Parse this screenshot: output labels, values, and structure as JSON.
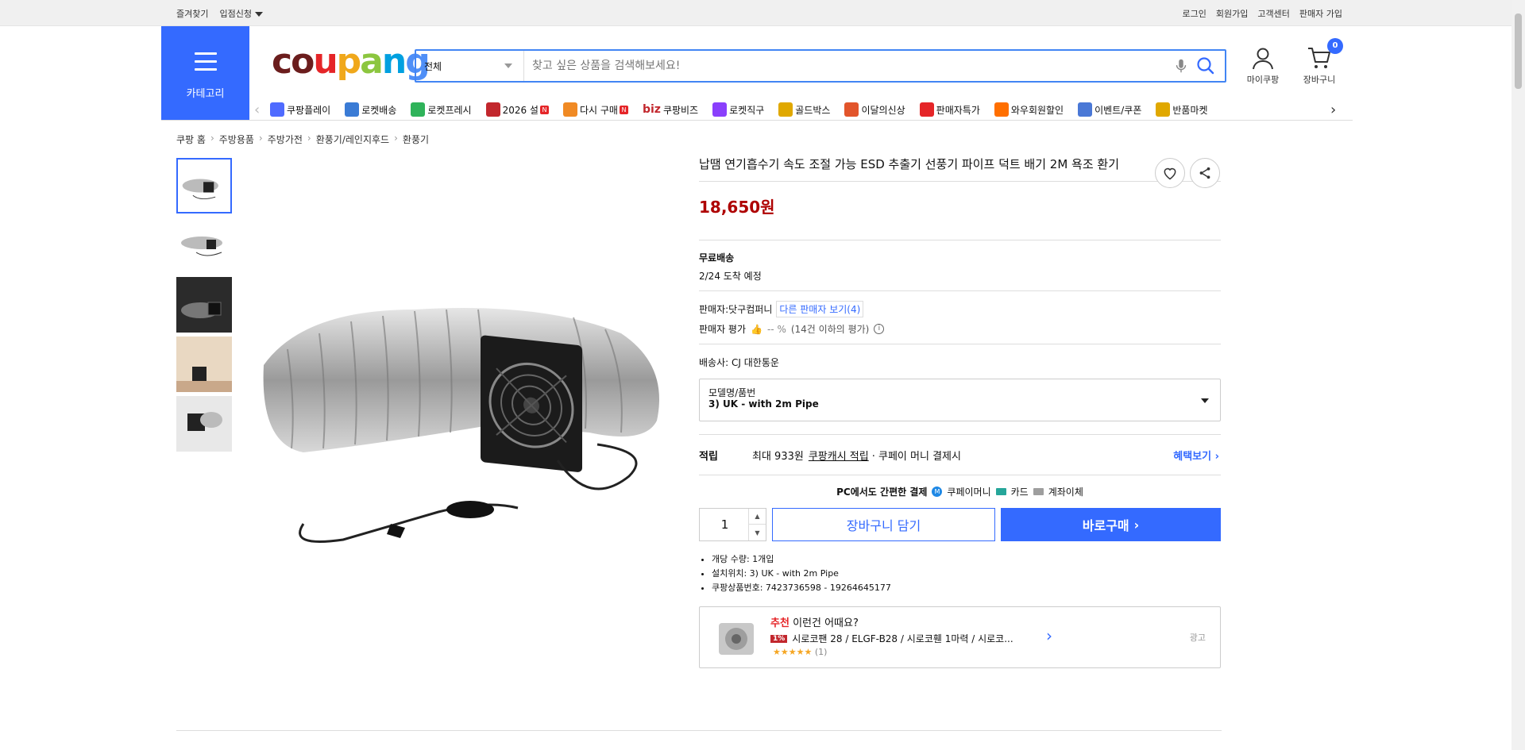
{
  "topbar": {
    "left": [
      "즐겨찾기",
      "입점신청"
    ],
    "right": [
      "로그인",
      "회원가입",
      "고객센터",
      "판매자 가입"
    ]
  },
  "header": {
    "category_label": "카테고리",
    "logo": "coupang",
    "search_scope": "전체",
    "search_placeholder": "찾고 싶은 상품을 검색해보세요!",
    "mypage_label": "마이쿠팡",
    "cart_label": "장바구니",
    "cart_count": "0"
  },
  "nav": [
    {
      "label": "쿠팡플레이",
      "color": "#4f6bff"
    },
    {
      "label": "로켓배송",
      "color": "#3a7bd5"
    },
    {
      "label": "로켓프레시",
      "color": "#2fb35a"
    },
    {
      "label": "2026 설",
      "color": "#c2272d",
      "badge": "N"
    },
    {
      "label": "다시 구매",
      "color": "#f08a24",
      "badge": "N"
    },
    {
      "label": "쿠팡비즈",
      "color": "#c2272d",
      "prefix": "biz"
    },
    {
      "label": "로켓직구",
      "color": "#8a3ffc"
    },
    {
      "label": "골드박스",
      "color": "#e0a800"
    },
    {
      "label": "이달의신상",
      "color": "#e2552b"
    },
    {
      "label": "판매자특가",
      "color": "#e52528"
    },
    {
      "label": "와우회원할인",
      "color": "#ff6f00"
    },
    {
      "label": "이벤트/쿠폰",
      "color": "#4a78d6"
    },
    {
      "label": "반품마켓",
      "color": "#e0a800"
    }
  ],
  "breadcrumb": [
    "쿠팡 홈",
    "주방용품",
    "주방가전",
    "환풍기/레인지후드",
    "환풍기"
  ],
  "product": {
    "title": "납땜 연기흡수기 속도 조절 가능 ESD 추출기 선풍기 파이프 덕트 배기 2M 욕조 환기",
    "price": "18,650원",
    "shipping_title": "무료배송",
    "arrival": "2/24 도착 예정",
    "seller_label": "판매자:",
    "seller_name": "닷구컴퍼니",
    "other_sellers": "다른 판매자 보기(4)",
    "rating_label": "판매자 평가",
    "rating_value": "-- %",
    "rating_note": "(14건 이하의 평가)",
    "courier_label": "배송사:",
    "courier": "CJ 대한통운",
    "option_label": "모델명/품번",
    "option_value": "3) UK - with 2m Pipe",
    "reward_label": "적립",
    "reward_text": "최대 933원",
    "reward_link": "쿠팡캐시 적립",
    "reward_suffix": "· 쿠페이 머니 결제시",
    "benefit_link": "혜택보기",
    "pay_title": "PC에서도 간편한 결제",
    "pay_methods": [
      "쿠페이머니",
      "카드",
      "계좌이체"
    ],
    "quantity": "1",
    "cart_button": "장바구니 담기",
    "buy_button": "바로구매",
    "specs": [
      "개당 수량: 1개입",
      "설치위치: 3) UK - with 2m Pipe",
      "쿠팡상품번호: 7423736598 - 19264645177"
    ]
  },
  "recommend": {
    "label_red": "추천",
    "label": "이런건 어때요?",
    "discount": "1%",
    "name": "시로코팬 28 / ELGF-B28 / 시로코휀 1마력 / 시로코...",
    "stars": "★★★★★",
    "reviews": "(1)",
    "ad": "광고"
  }
}
